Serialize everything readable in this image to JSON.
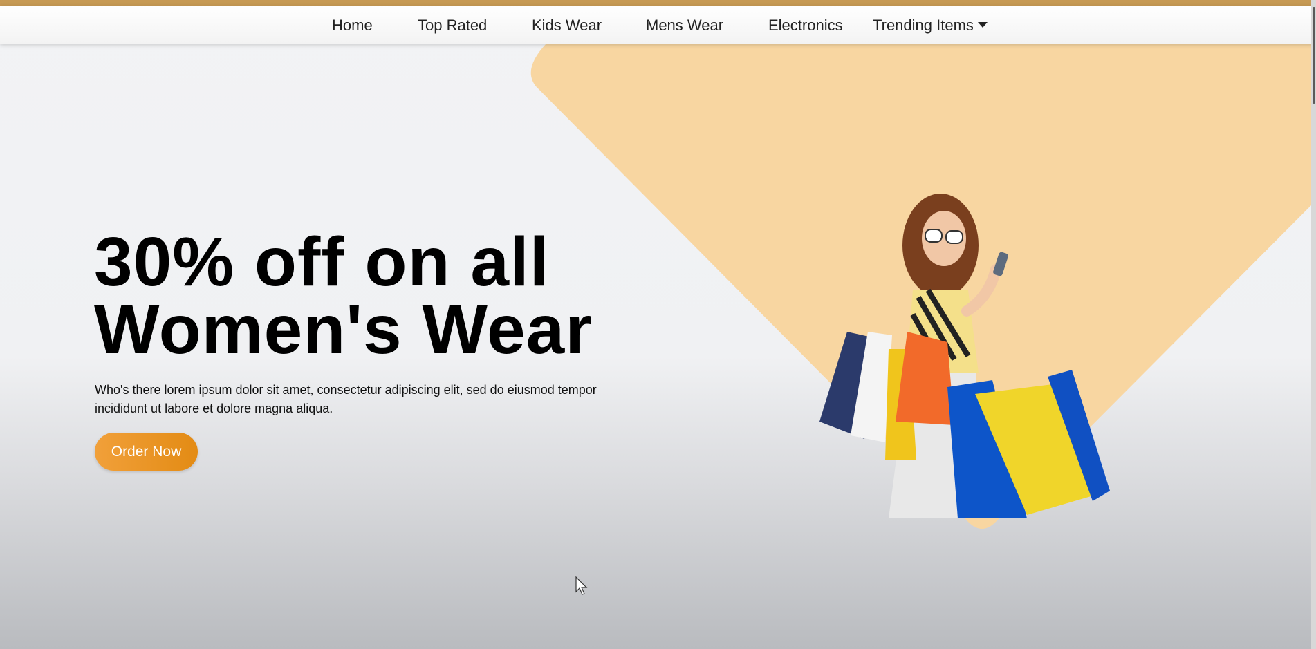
{
  "nav": {
    "items": [
      {
        "label": "Home"
      },
      {
        "label": "Top Rated"
      },
      {
        "label": "Kids Wear"
      },
      {
        "label": "Mens Wear"
      },
      {
        "label": "Electronics"
      },
      {
        "label": "Trending Items"
      }
    ],
    "dropdown_icon": "caret-down-icon"
  },
  "hero": {
    "headline_line1": "30% off on all",
    "headline_line2": "Women's Wear",
    "description": "Who's there lorem ipsum dolor sit amet, consectetur adipiscing elit, sed do eiusmod tempor incididunt ut labore et dolore magna aliqua.",
    "cta_label": "Order Now"
  },
  "colors": {
    "accent": "#e8921e",
    "shape": "#f8d6a1"
  }
}
